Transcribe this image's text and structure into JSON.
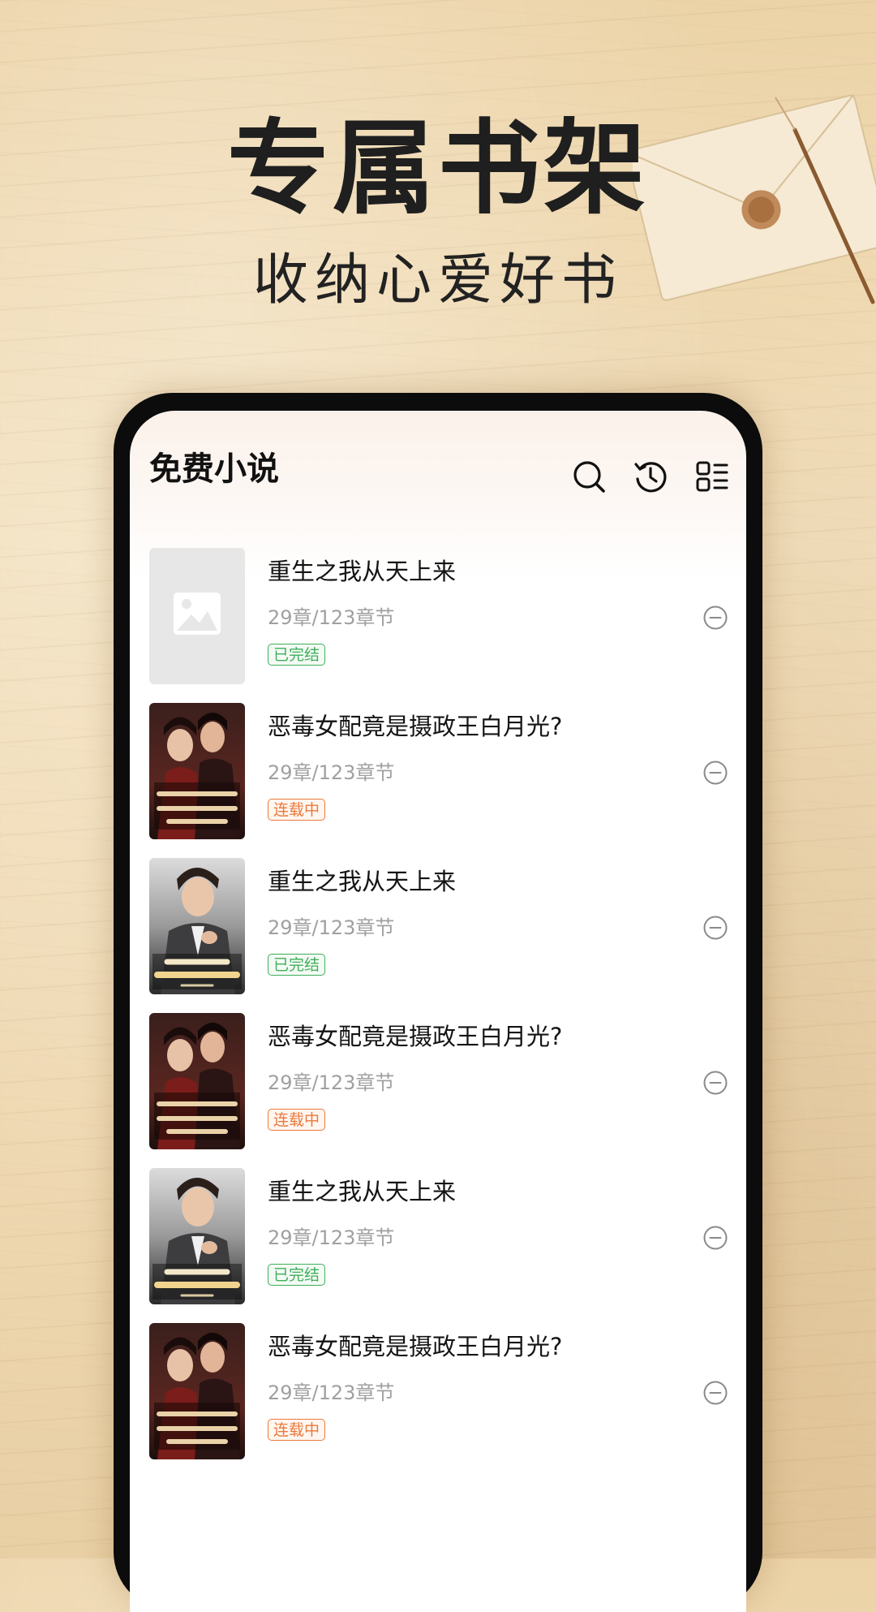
{
  "hero": {
    "title": "专属书架",
    "subtitle": "收纳心爱好书"
  },
  "app": {
    "title": "免费小说",
    "icons": [
      "search-icon",
      "history-icon",
      "layout-toggle-icon"
    ]
  },
  "books": [
    {
      "title": "重生之我从天上来",
      "progress": "29章/123章节",
      "status": "已完结",
      "status_type": "done",
      "cover": "placeholder"
    },
    {
      "title": "恶毒女配竟是摄政王白月光?",
      "progress": "29章/123章节",
      "status": "连载中",
      "status_type": "ongoing",
      "cover": "couple"
    },
    {
      "title": "重生之我从天上来",
      "progress": "29章/123章节",
      "status": "已完结",
      "status_type": "done",
      "cover": "man"
    },
    {
      "title": "恶毒女配竟是摄政王白月光?",
      "progress": "29章/123章节",
      "status": "连载中",
      "status_type": "ongoing",
      "cover": "couple"
    },
    {
      "title": "重生之我从天上来",
      "progress": "29章/123章节",
      "status": "已完结",
      "status_type": "done",
      "cover": "man"
    },
    {
      "title": "恶毒女配竟是摄政王白月光?",
      "progress": "29章/123章节",
      "status": "连载中",
      "status_type": "ongoing",
      "cover": "couple"
    }
  ],
  "colors": {
    "status_done": "#3fae5a",
    "status_ongoing": "#ea7a3c",
    "background": "#f0dcb6"
  }
}
